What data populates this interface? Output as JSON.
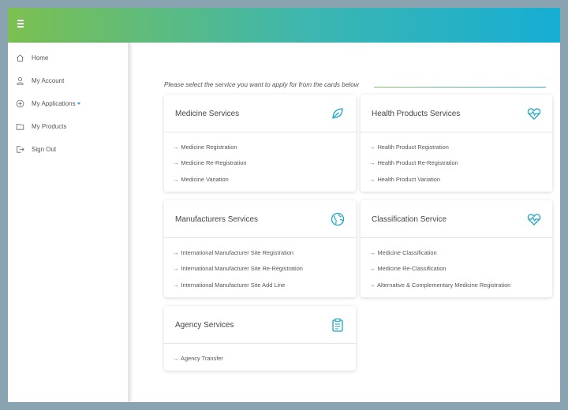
{
  "topbar": {
    "menu_icon": "hamburger-icon",
    "gradient": [
      "#7cc050",
      "#16aed4"
    ]
  },
  "sidebar": {
    "items": [
      {
        "label": "Home",
        "icon": "home-icon"
      },
      {
        "label": "My Account",
        "icon": "user-icon"
      },
      {
        "label": "My Applications",
        "icon": "plus-circle-icon",
        "has_dropdown": true
      },
      {
        "label": "My Products",
        "icon": "folder-icon"
      },
      {
        "label": "Sign Out",
        "icon": "sign-out-icon"
      }
    ]
  },
  "main": {
    "instruction": "Please select the service you want to apply for from the cards below",
    "arrow": "→",
    "accent_color": "#1aa6c2",
    "cards": [
      {
        "title": "Medicine Services",
        "icon": "leaf-icon",
        "links": [
          "Medicine Registration",
          "Medicine Re-Registration",
          "Medicine Variation"
        ]
      },
      {
        "title": "Health Products Services",
        "icon": "heartbeat-icon",
        "links": [
          "Health Product Registration",
          "Health Product Re-Registration",
          "Health Product Variation"
        ]
      },
      {
        "title": "Manufacturers Services",
        "icon": "globe-icon",
        "links": [
          "International Manufacturer Site Registration",
          "International Manufacturer Site Re-Registration",
          "International Manufacturer Site Add Line"
        ]
      },
      {
        "title": "Classification Service",
        "icon": "heartbeat-icon",
        "links": [
          "Medicine Classification",
          "Medicine Re-Classification",
          "Alternative & Complementary Medicine Registration"
        ]
      },
      {
        "title": "Agency Services",
        "icon": "clipboard-icon",
        "links": [
          "Agency Transfer"
        ]
      }
    ]
  }
}
